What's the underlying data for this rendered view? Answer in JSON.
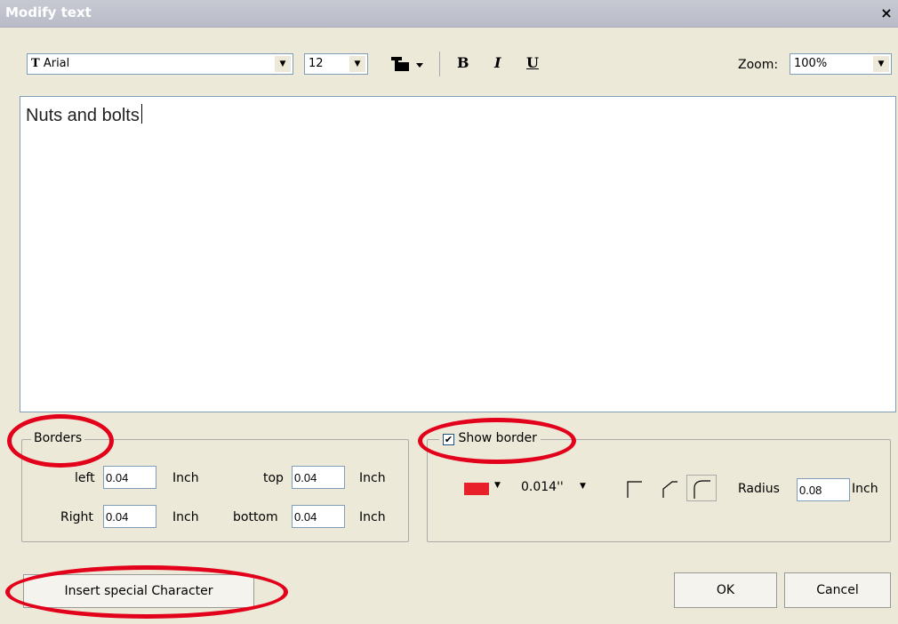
{
  "window": {
    "title": "Modify text",
    "close_glyph": "×"
  },
  "toolbar": {
    "font_icon": "T",
    "font_name": "Arial",
    "font_size": "12",
    "bold": "B",
    "italic": "I",
    "underline": "U",
    "zoom_label": "Zoom:",
    "zoom_value": "100%"
  },
  "editor": {
    "text": "Nuts and bolts"
  },
  "borders": {
    "legend": "Borders",
    "left_label": "left",
    "left_value": "0.04",
    "right_label": "Right",
    "right_value": "0.04",
    "top_label": "top",
    "top_value": "0.04",
    "bottom_label": "bottom",
    "bottom_value": "0.04",
    "unit": "Inch"
  },
  "show_border": {
    "label": "Show border",
    "checked": true,
    "color": "#e8202a",
    "line_width": "0.014''",
    "radius_label": "Radius",
    "radius_value": "0.08",
    "unit": "Inch"
  },
  "footer": {
    "special_char_label": "Insert special Character",
    "ok_label": "OK",
    "cancel_label": "Cancel"
  },
  "colors": {
    "highlight": "#e3001b"
  }
}
